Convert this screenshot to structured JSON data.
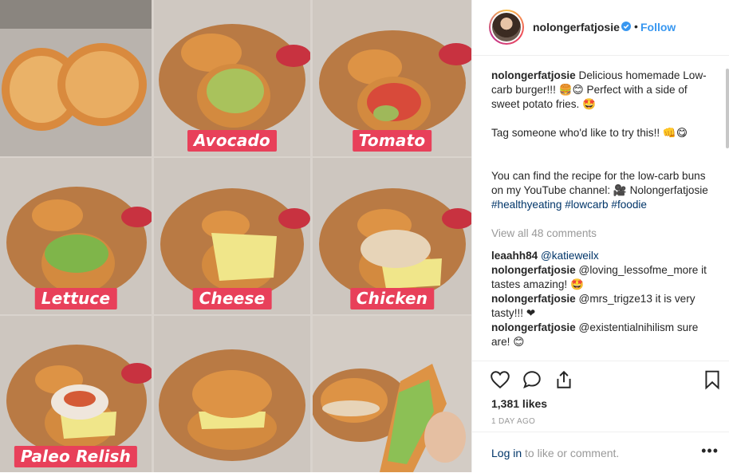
{
  "post": {
    "panels": [
      {
        "label": ""
      },
      {
        "label": "Avocado"
      },
      {
        "label": "Tomato"
      },
      {
        "label": "Lettuce"
      },
      {
        "label": "Cheese"
      },
      {
        "label": "Chicken"
      },
      {
        "label": "Paleo Relish"
      },
      {
        "label": ""
      },
      {
        "label": ""
      }
    ]
  },
  "header": {
    "username": "nolongerfatjosie",
    "separator": "•",
    "follow_label": "Follow"
  },
  "caption": {
    "username": "nolongerfatjosie",
    "line1": "Delicious homemade Low-carb burger!!! 🍔😊 Perfect with a side of sweet potato fries. 🤩",
    "line2": "Tag someone who'd like to try this!! 👊😋",
    "line3": "You can find the recipe for the low-carb buns on my YouTube channel: 🎥 Nolongerfatjosie",
    "hashtags": "#healthyeating #lowcarb #foodie"
  },
  "view_all_comments": "View all 48 comments",
  "comments": [
    {
      "username": "leaahh84",
      "text": "@katieweilx"
    },
    {
      "username": "nolongerfatjosie",
      "text": "@loving_lessofme_more it tastes amazing! 🤩"
    },
    {
      "username": "nolongerfatjosie",
      "text": "@mrs_trigze13 it is very tasty!!! ❤"
    },
    {
      "username": "nolongerfatjosie",
      "text": "@existentialnihilism sure are! 😊"
    }
  ],
  "actions": {
    "like_icon": "heart-icon",
    "comment_icon": "comment-icon",
    "share_icon": "share-icon",
    "save_icon": "bookmark-icon"
  },
  "likes": "1,381 likes",
  "time_ago": "1 DAY AGO",
  "login": {
    "link": "Log in",
    "rest": "to like or comment.",
    "more": "•••"
  },
  "colors": {
    "label_bg": "#e8405a",
    "link_blue": "#3897f0",
    "muted": "#999999"
  }
}
